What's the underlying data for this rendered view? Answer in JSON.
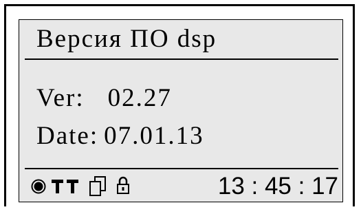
{
  "display": {
    "title": "Версия ПО dsp",
    "version_label": "Ver:",
    "version_value": "02.27",
    "date_label": "Date:",
    "date_value": "07.01.13"
  },
  "status_bar": {
    "icons": [
      "record-indicator-icon",
      "signal-antenna-icon",
      "pages-icon",
      "lock-icon"
    ],
    "clock": "13 : 45 : 17"
  }
}
